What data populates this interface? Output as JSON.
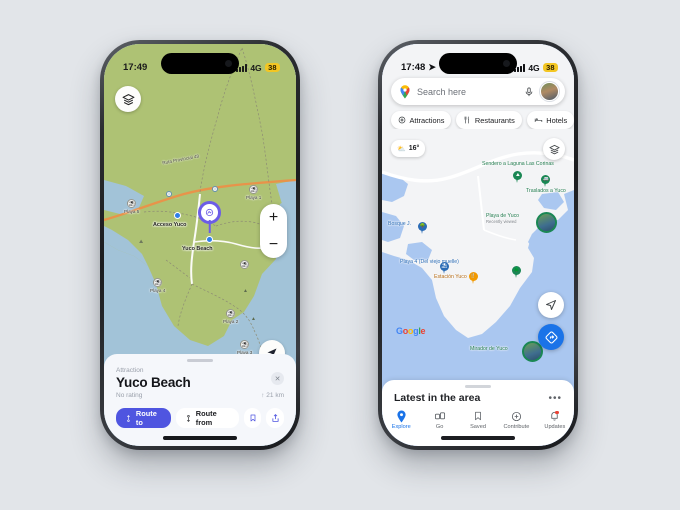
{
  "background_color": "#e2e5e9",
  "left_phone": {
    "app": "Organic Maps",
    "status_bar": {
      "time": "17:49",
      "network": "4G",
      "battery": "38",
      "battery_color": "#f3c623"
    },
    "controls": {
      "layers_icon": "layers-icon",
      "zoom_in": "+",
      "zoom_out": "−",
      "locate_icon": "navigation-arrow-icon"
    },
    "map": {
      "land_color": "#aec274",
      "water_color": "#a2c3d8",
      "road_color": "#e8934a",
      "road_label": "Ruta Provincial 48",
      "selected_marker_color": "#6c5ce7",
      "point_labels": [
        {
          "text": "Acceso Yuco"
        },
        {
          "text": "Yuco Beach"
        }
      ],
      "beaches": [
        {
          "name": "Playa 5",
          "icon": "beach-icon"
        },
        {
          "name": "Playa 1",
          "icon": "beach-icon"
        },
        {
          "name": "Playa 4",
          "icon": "beach-icon"
        },
        {
          "name": "Playa 2",
          "icon": "beach-icon"
        },
        {
          "name": "Playa 3",
          "icon": "beach-icon"
        }
      ]
    },
    "place_card": {
      "category": "Attraction",
      "title": "Yuco Beach",
      "rating": "No rating",
      "distance": "21 km",
      "distance_icon": "↑",
      "close_icon": "✕",
      "route_to_label": "Route to",
      "route_to_color": "#4f55e0",
      "route_from_label": "Route from",
      "bookmark_icon": "bookmark-icon",
      "share_icon": "share-icon"
    }
  },
  "right_phone": {
    "app": "Google Maps",
    "status_bar": {
      "time": "17:48",
      "location_icon": "➤",
      "network": "4G",
      "battery": "38",
      "battery_color": "#f3c623"
    },
    "search": {
      "placeholder": "Search here",
      "pin_icon": "google-maps-pin-icon",
      "mic_icon": "microphone-icon",
      "avatar": "user-avatar"
    },
    "chips": [
      {
        "label": "Attractions",
        "icon": "attractions-icon"
      },
      {
        "label": "Restaurants",
        "icon": "restaurant-icon"
      },
      {
        "label": "Hotels",
        "icon": "hotel-icon"
      },
      {
        "label": "",
        "icon": "shopping-cart-icon"
      }
    ],
    "weather": {
      "temperature": "16°",
      "icon": "partly-cloudy-icon"
    },
    "layers_icon": "layers-icon",
    "map": {
      "land_color": "#f3f4f6",
      "water_color": "#aac7f0",
      "road_color": "#ffffff",
      "pois": [
        {
          "name": "Sendero a Laguna Las Corinas",
          "color": "#1a8754",
          "icon": "trail-icon"
        },
        {
          "name": "Traslados a Yuco",
          "color": "#1a8754",
          "icon": "transport-icon"
        },
        {
          "name": "Playa de Yuco",
          "subtitle": "Recently viewed",
          "color": "#1a8754",
          "icon": "photo-pin"
        },
        {
          "name": "Bosque J.",
          "color": "#2a6bb5",
          "icon": "park-icon"
        },
        {
          "name": "Playa 4 (Del viejo muelle)",
          "color": "#2a6bb5",
          "icon": "beach-icon"
        },
        {
          "name": "Estación Yuco",
          "color": "#f29900",
          "icon": "restaurant-icon"
        },
        {
          "name": "Mirador de Yuco",
          "color": "#1a8754",
          "icon": "photo-pin"
        }
      ],
      "watermark": "Google"
    },
    "fabs": {
      "locate_icon": "navigation-arrow-icon",
      "directions_icon": "directions-icon",
      "directions_color": "#1a73e8"
    },
    "bottom_sheet": {
      "title": "Latest in the area",
      "more_icon": "•••",
      "tabs": [
        {
          "label": "Explore",
          "icon": "pin-icon",
          "active": true
        },
        {
          "label": "Go",
          "icon": "commute-icon",
          "active": false
        },
        {
          "label": "Saved",
          "icon": "bookmark-icon",
          "active": false
        },
        {
          "label": "Contribute",
          "icon": "plus-circle-icon",
          "active": false
        },
        {
          "label": "Updates",
          "icon": "bell-icon",
          "active": false,
          "badge": true
        }
      ],
      "active_color": "#1a73e8"
    }
  }
}
